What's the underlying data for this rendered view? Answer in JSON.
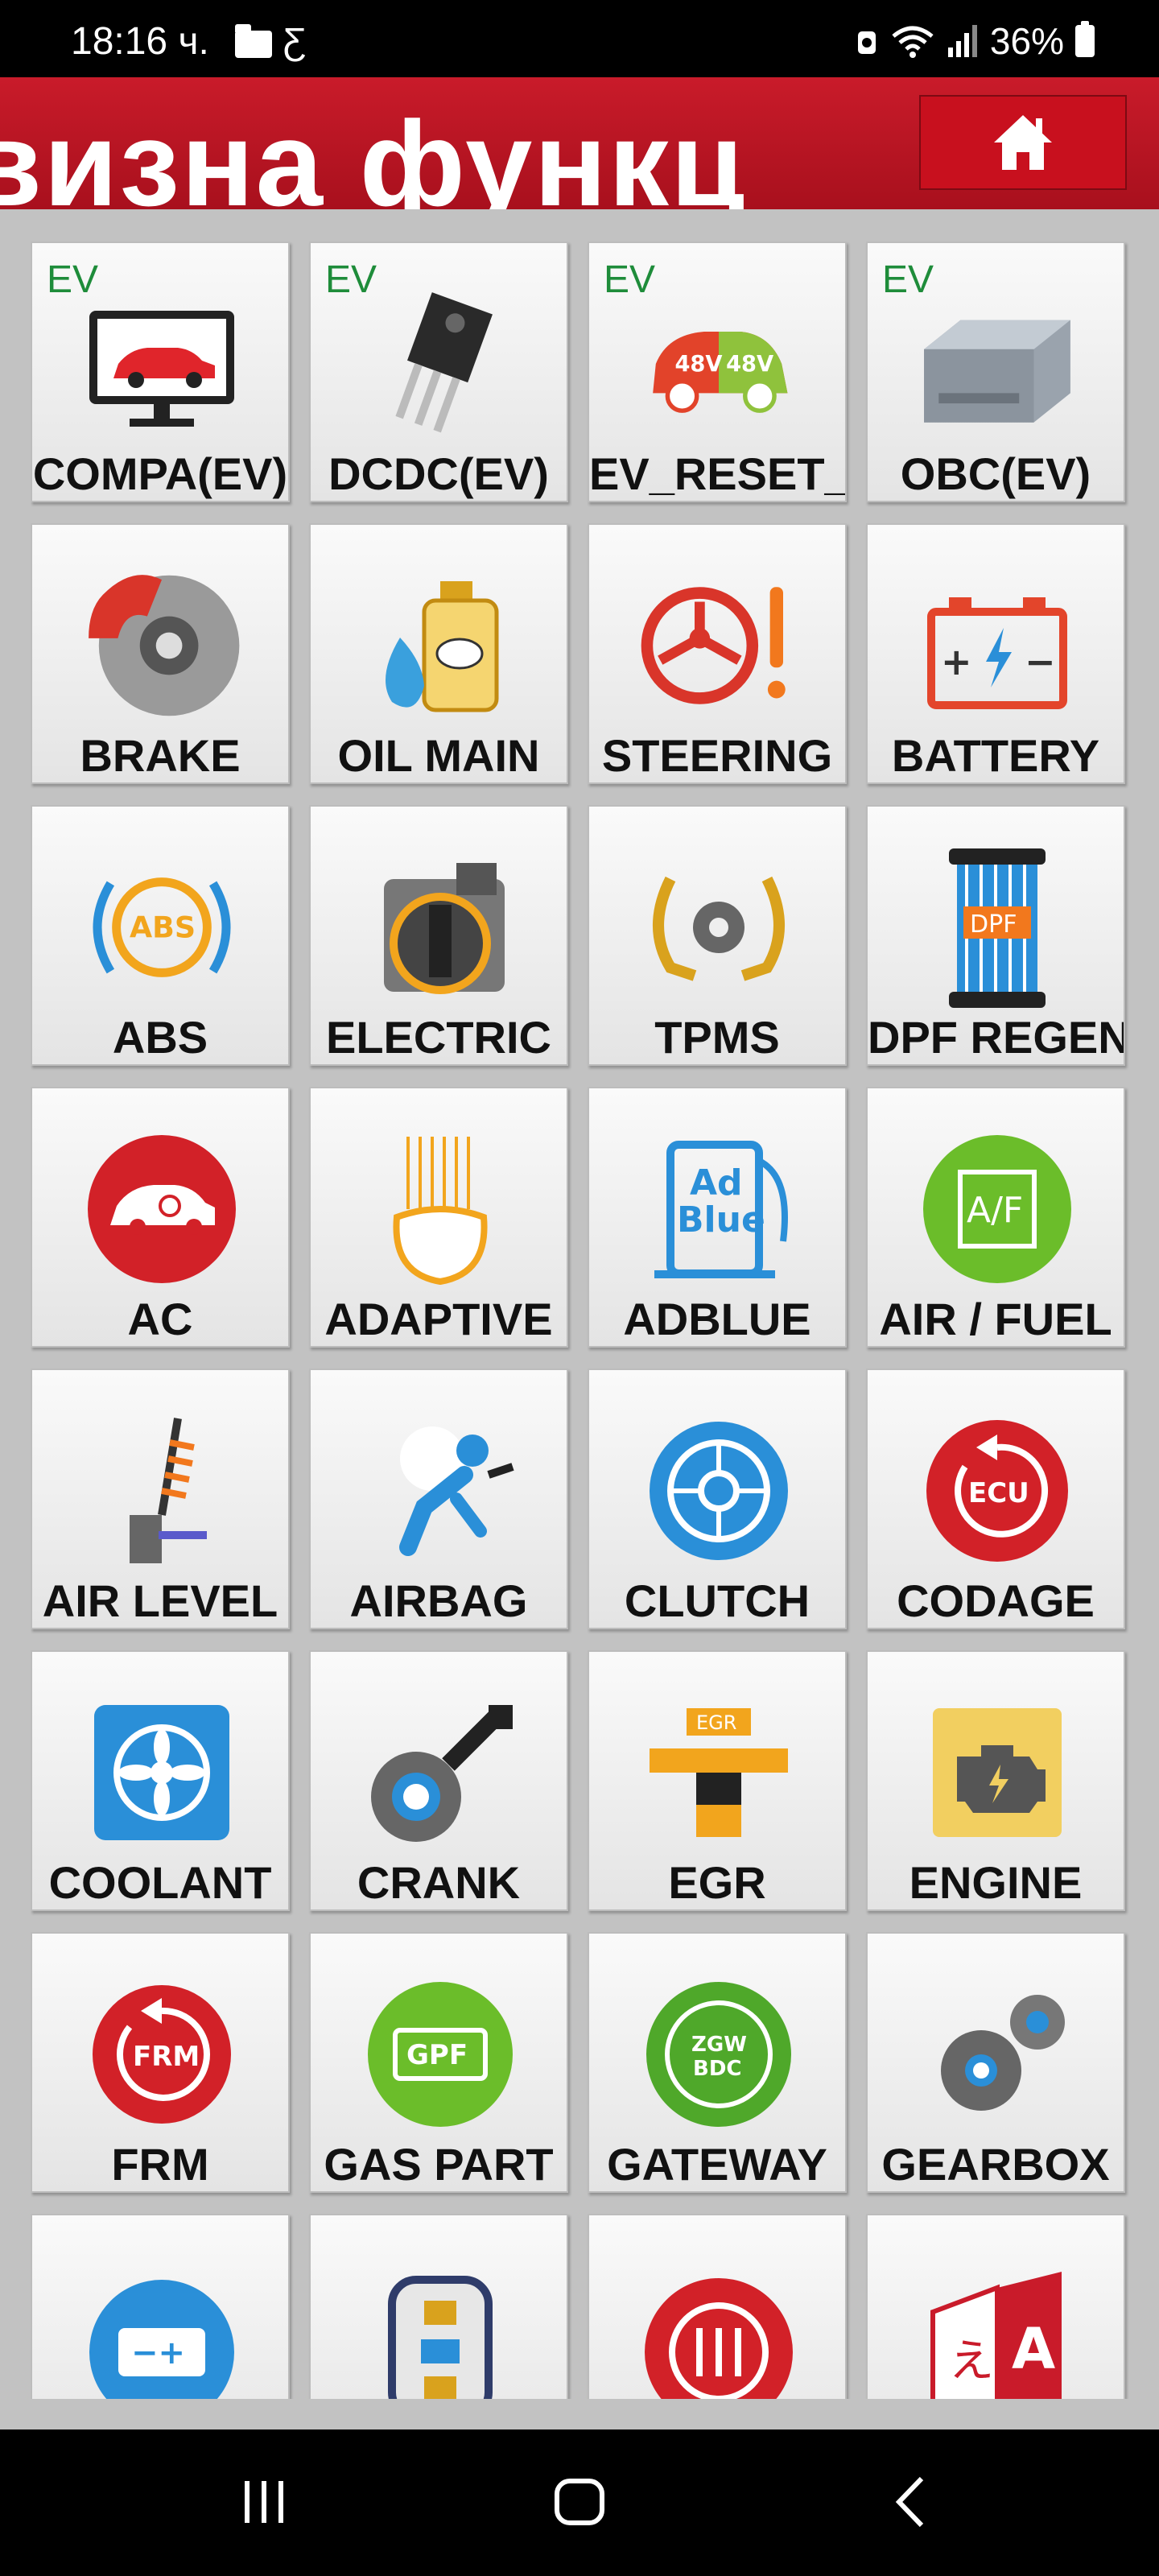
{
  "status_bar": {
    "time": "18:16 ч.",
    "glyph": "Ƹ",
    "battery": "36%"
  },
  "header": {
    "title": "визна функц",
    "home_icon": "home-icon"
  },
  "tiles": [
    {
      "label": "COMPA(EV)",
      "badge": "EV",
      "icon": "monitor-car-icon"
    },
    {
      "label": "DCDC(EV)",
      "badge": "EV",
      "icon": "transistor-icon"
    },
    {
      "label": "EV_RESET_",
      "badge": "EV",
      "icon": "48v-car-icon"
    },
    {
      "label": "OBC(EV)",
      "badge": "EV",
      "icon": "battery-pack-icon"
    },
    {
      "label": "BRAKE",
      "badge": "",
      "icon": "brake-disc-icon"
    },
    {
      "label": "OIL MAIN",
      "badge": "",
      "icon": "oil-bottle-icon"
    },
    {
      "label": "STEERING",
      "badge": "",
      "icon": "steering-warning-icon"
    },
    {
      "label": "BATTERY",
      "badge": "",
      "icon": "battery-icon"
    },
    {
      "label": "ABS",
      "badge": "",
      "icon": "abs-icon"
    },
    {
      "label": "ELECTRIC",
      "badge": "",
      "icon": "throttle-body-icon"
    },
    {
      "label": "TPMS",
      "badge": "",
      "icon": "tpms-icon"
    },
    {
      "label": "DPF REGEN",
      "badge": "",
      "icon": "dpf-icon"
    },
    {
      "label": "AC",
      "badge": "",
      "icon": "ac-car-icon"
    },
    {
      "label": "ADAPTIVE",
      "badge": "",
      "icon": "headlight-icon"
    },
    {
      "label": "ADBLUE",
      "badge": "",
      "icon": "adblue-icon"
    },
    {
      "label": "AIR / FUEL",
      "badge": "",
      "icon": "air-fuel-icon"
    },
    {
      "label": "AIR LEVEL",
      "badge": "",
      "icon": "suspension-icon"
    },
    {
      "label": "AIRBAG",
      "badge": "",
      "icon": "airbag-icon"
    },
    {
      "label": "CLUTCH",
      "badge": "",
      "icon": "clutch-icon"
    },
    {
      "label": "CODAGE",
      "badge": "",
      "icon": "ecu-icon"
    },
    {
      "label": "COOLANT",
      "badge": "",
      "icon": "coolant-fan-icon"
    },
    {
      "label": "CRANK",
      "badge": "",
      "icon": "crank-sensor-icon"
    },
    {
      "label": "EGR",
      "badge": "",
      "icon": "egr-valve-icon"
    },
    {
      "label": "ENGINE",
      "badge": "",
      "icon": "engine-warning-icon"
    },
    {
      "label": "FRM",
      "badge": "",
      "icon": "frm-icon"
    },
    {
      "label": "GAS PART",
      "badge": "",
      "icon": "gpf-icon"
    },
    {
      "label": "GATEWAY",
      "badge": "",
      "icon": "gateway-icon"
    },
    {
      "label": "GEARBOX",
      "badge": "",
      "icon": "gears-icon"
    },
    {
      "label": "",
      "badge": "",
      "icon": "battery-reset-icon"
    },
    {
      "label": "",
      "badge": "",
      "icon": "key-lock-icon"
    },
    {
      "label": "",
      "badge": "",
      "icon": "sliders-target-icon"
    },
    {
      "label": "",
      "badge": "",
      "icon": "language-icon"
    }
  ]
}
